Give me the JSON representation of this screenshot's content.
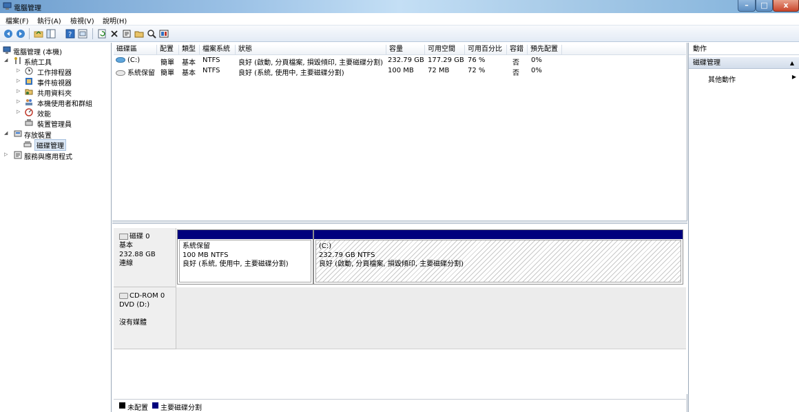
{
  "window": {
    "title": "電腦管理"
  },
  "menu": [
    "檔案(F)",
    "執行(A)",
    "檢視(V)",
    "說明(H)"
  ],
  "toolbar": {
    "icons": [
      "back-icon",
      "forward-icon",
      "up-folder-icon",
      "show-tree-icon",
      "help-icon",
      "console-icon",
      "refresh-icon",
      "delete-icon",
      "properties-icon",
      "open-icon",
      "search-icon",
      "disk-settings-icon"
    ]
  },
  "tree": {
    "root": "電腦管理 (本機)",
    "system_tools": "系統工具",
    "task_scheduler": "工作排程器",
    "event_viewer": "事件檢視器",
    "shared_folders": "共用資料夾",
    "local_users": "本機使用者和群組",
    "performance": "效能",
    "device_manager": "裝置管理員",
    "storage": "存放裝置",
    "disk_management": "磁碟管理",
    "services": "服務與應用程式"
  },
  "volume_table": {
    "columns": [
      "磁碟區",
      "配置",
      "類型",
      "檔案系統",
      "狀態",
      "容量",
      "可用空間",
      "可用百分比",
      "容錯",
      "預先配置"
    ],
    "rows": [
      {
        "volume": "(C:)",
        "layout": "簡單",
        "type": "基本",
        "fs": "NTFS",
        "status": "良好 (啟動, 分頁檔案, 損毀傾印, 主要磁碟分割)",
        "capacity": "232.79 GB",
        "free": "177.29 GB",
        "pct_free": "76 %",
        "fault_tolerance": "否",
        "overhead": "0%",
        "icon_color": "#5fa6dc"
      },
      {
        "volume": "系統保留",
        "layout": "簡單",
        "type": "基本",
        "fs": "NTFS",
        "status": "良好 (系統, 使用中, 主要磁碟分割)",
        "capacity": "100 MB",
        "free": "72 MB",
        "pct_free": "72 %",
        "fault_tolerance": "否",
        "overhead": "0%",
        "icon_color": "#d6d6d6"
      }
    ]
  },
  "disks": {
    "disk0": {
      "name": "磁碟 0",
      "type": "基本",
      "size": "232.88 GB",
      "status": "連線",
      "partitions": [
        {
          "name": "系統保留",
          "size_fs": "100 MB NTFS",
          "status": "良好 (系統, 使用中, 主要磁碟分割)"
        },
        {
          "name": "(C:)",
          "size_fs": "232.79 GB NTFS",
          "status": "良好 (啟動, 分頁檔案, 損毀傾印, 主要磁碟分割)"
        }
      ]
    },
    "cdrom0": {
      "name": "CD-ROM 0",
      "type": "DVD (D:)",
      "status": "沒有媒體"
    }
  },
  "legend": {
    "unallocated": "未配置",
    "primary": "主要磁碟分割",
    "unallocated_color": "#000000",
    "primary_color": "#00007d"
  },
  "actions": {
    "header": "動作",
    "group": "磁碟管理",
    "more": "其他動作"
  }
}
